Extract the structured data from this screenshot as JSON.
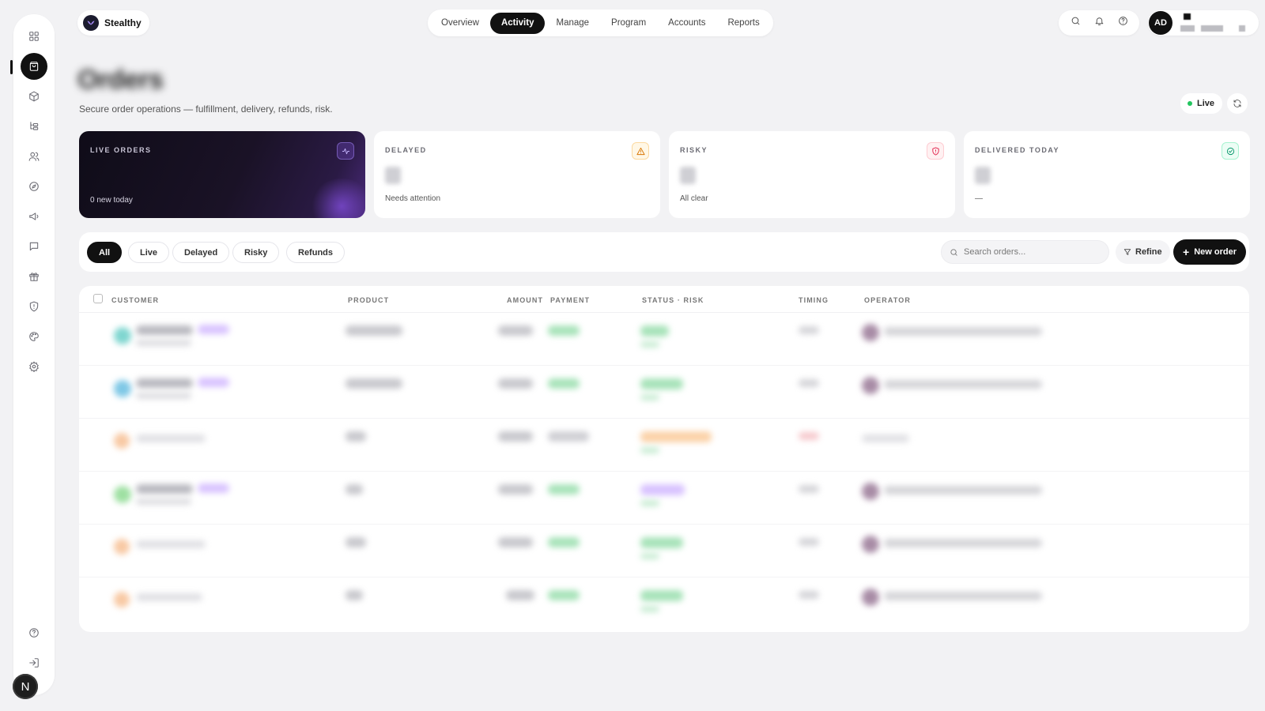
{
  "brand": {
    "name": "Stealthy"
  },
  "nav": {
    "tabs": [
      "Overview",
      "Activity",
      "Manage",
      "Program",
      "Accounts",
      "Reports"
    ],
    "active": "Activity"
  },
  "user": {
    "initials": "AD"
  },
  "sidebar": {
    "icons": [
      "grid-icon",
      "shopping-bag-icon",
      "package-icon",
      "hierarchy-icon",
      "users-icon",
      "compass-icon",
      "megaphone-icon",
      "message-icon",
      "gift-icon",
      "shield-icon",
      "palette-icon",
      "settings-icon",
      "help-icon",
      "logout-icon"
    ],
    "active": "shopping-bag-icon",
    "footer_avatar": "N"
  },
  "header": {
    "title": "Orders",
    "subtitle": "Secure order operations — fulfillment, delivery, refunds, risk.",
    "live_label": "Live"
  },
  "stats": [
    {
      "label": "LIVE ORDERS",
      "sub": "0 new today",
      "icon": "activity-icon"
    },
    {
      "label": "DELAYED",
      "sub": "Needs attention",
      "icon": "warning-icon",
      "accent": "#f59e0b"
    },
    {
      "label": "RISKY",
      "sub": "All clear",
      "icon": "shield-alert-icon",
      "accent": "#e11d48"
    },
    {
      "label": "DELIVERED TODAY",
      "sub": "—",
      "icon": "check-circle-icon",
      "accent": "#10b981"
    }
  ],
  "filters": {
    "chips": [
      "All",
      "Live",
      "Delayed",
      "Risky",
      "Refunds"
    ],
    "active": "All",
    "search_placeholder": "Search orders...",
    "refine_label": "Refine",
    "new_order_label": "New order"
  },
  "table": {
    "columns": [
      "CUSTOMER",
      "PRODUCT",
      "AMOUNT",
      "PAYMENT",
      "STATUS · RISK",
      "TIMING",
      "OPERATOR"
    ]
  },
  "colors": {
    "accent": "#111111",
    "live": "#22c55e",
    "dark_card_glow": "#8b5cf6"
  }
}
